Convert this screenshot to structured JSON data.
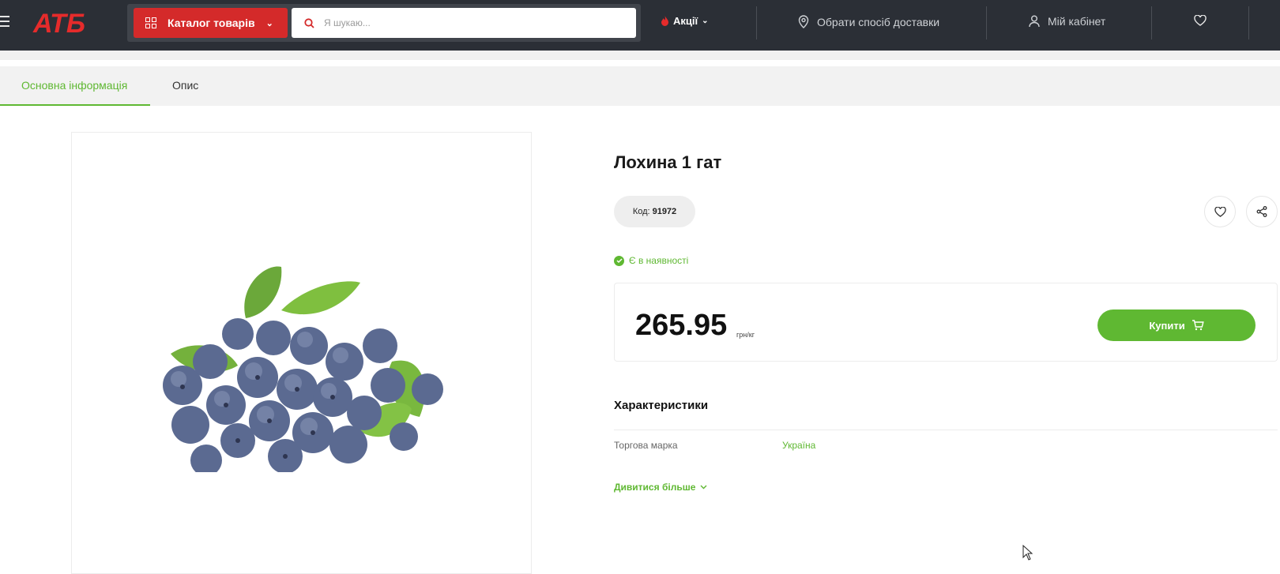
{
  "header": {
    "logo_text": "АТБ",
    "catalog_label": "Каталог товарів",
    "search_placeholder": "Я шукаю...",
    "promo_label": "Акції",
    "delivery_label": "Обрати спосіб доставки",
    "account_label": "Мій кабінет"
  },
  "tabs": {
    "main_info": "Основна інформація",
    "description": "Опис"
  },
  "product": {
    "title": "Лохина 1 гат",
    "code_label": "Код:",
    "code_value": "91972",
    "stock_status": "Є в наявності",
    "price": "265.95",
    "price_unit": "грн/кг",
    "buy_label": "Купити"
  },
  "characteristics": {
    "title": "Характеристики",
    "rows": [
      {
        "name": "Торгова марка",
        "value": "Україна"
      }
    ],
    "more_label": "Дивитися більше"
  },
  "colors": {
    "header_bg": "#2b2f36",
    "brand_red": "#d42a2a",
    "accent_green": "#5fb832"
  }
}
